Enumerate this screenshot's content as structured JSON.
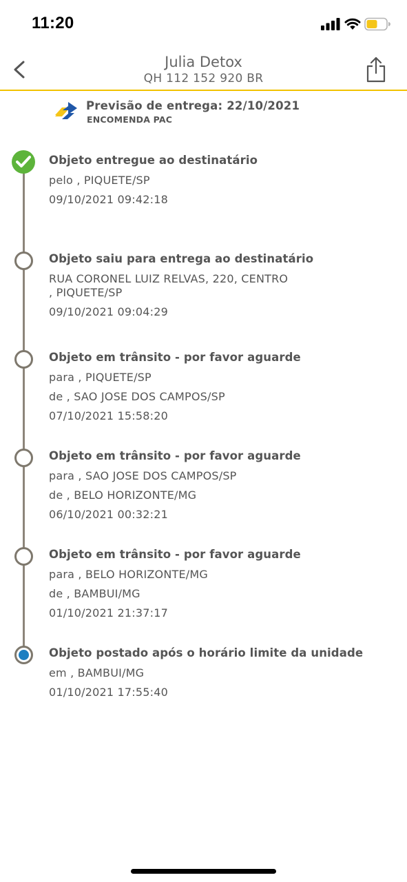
{
  "status_bar": {
    "time": "11:20",
    "battery_color": "#f5c518"
  },
  "header": {
    "title": "Julia Detox",
    "tracking_code": "QH 112 152 920 BR",
    "accent_color": "#f2c200",
    "back_icon": "chevron-left-icon",
    "share_icon": "share-icon"
  },
  "forecast": {
    "text": "Previsão de entrega: 22/10/2021",
    "service": "ENCOMENDA PAC"
  },
  "events": [
    {
      "status": "delivered",
      "title": "Objeto entregue ao destinatário",
      "lines": [
        "pelo , PIQUETE/SP",
        "09/10/2021 09:42:18"
      ]
    },
    {
      "status": "in-progress",
      "title": "Objeto saiu para entrega ao destinatário",
      "lines": [
        "RUA CORONEL LUIZ RELVAS, 220, CENTRO",
        ", PIQUETE/SP",
        "09/10/2021 09:04:29"
      ]
    },
    {
      "status": "in-progress",
      "title": "Objeto em trânsito - por favor aguarde",
      "lines": [
        "para , PIQUETE/SP",
        "de , SAO JOSE DOS CAMPOS/SP",
        "07/10/2021 15:58:20"
      ]
    },
    {
      "status": "in-progress",
      "title": "Objeto em trânsito - por favor aguarde",
      "lines": [
        "para , SAO JOSE DOS CAMPOS/SP",
        "de , BELO HORIZONTE/MG",
        "06/10/2021 00:32:21"
      ]
    },
    {
      "status": "in-progress",
      "title": "Objeto em trânsito - por favor aguarde",
      "lines": [
        "para , BELO HORIZONTE/MG",
        "de , BAMBUI/MG",
        "01/10/2021 21:37:17"
      ]
    },
    {
      "status": "posted",
      "title": "Objeto postado após o horário limite da unidade",
      "lines": [
        "em , BAMBUI/MG",
        "01/10/2021 17:55:40"
      ]
    }
  ]
}
